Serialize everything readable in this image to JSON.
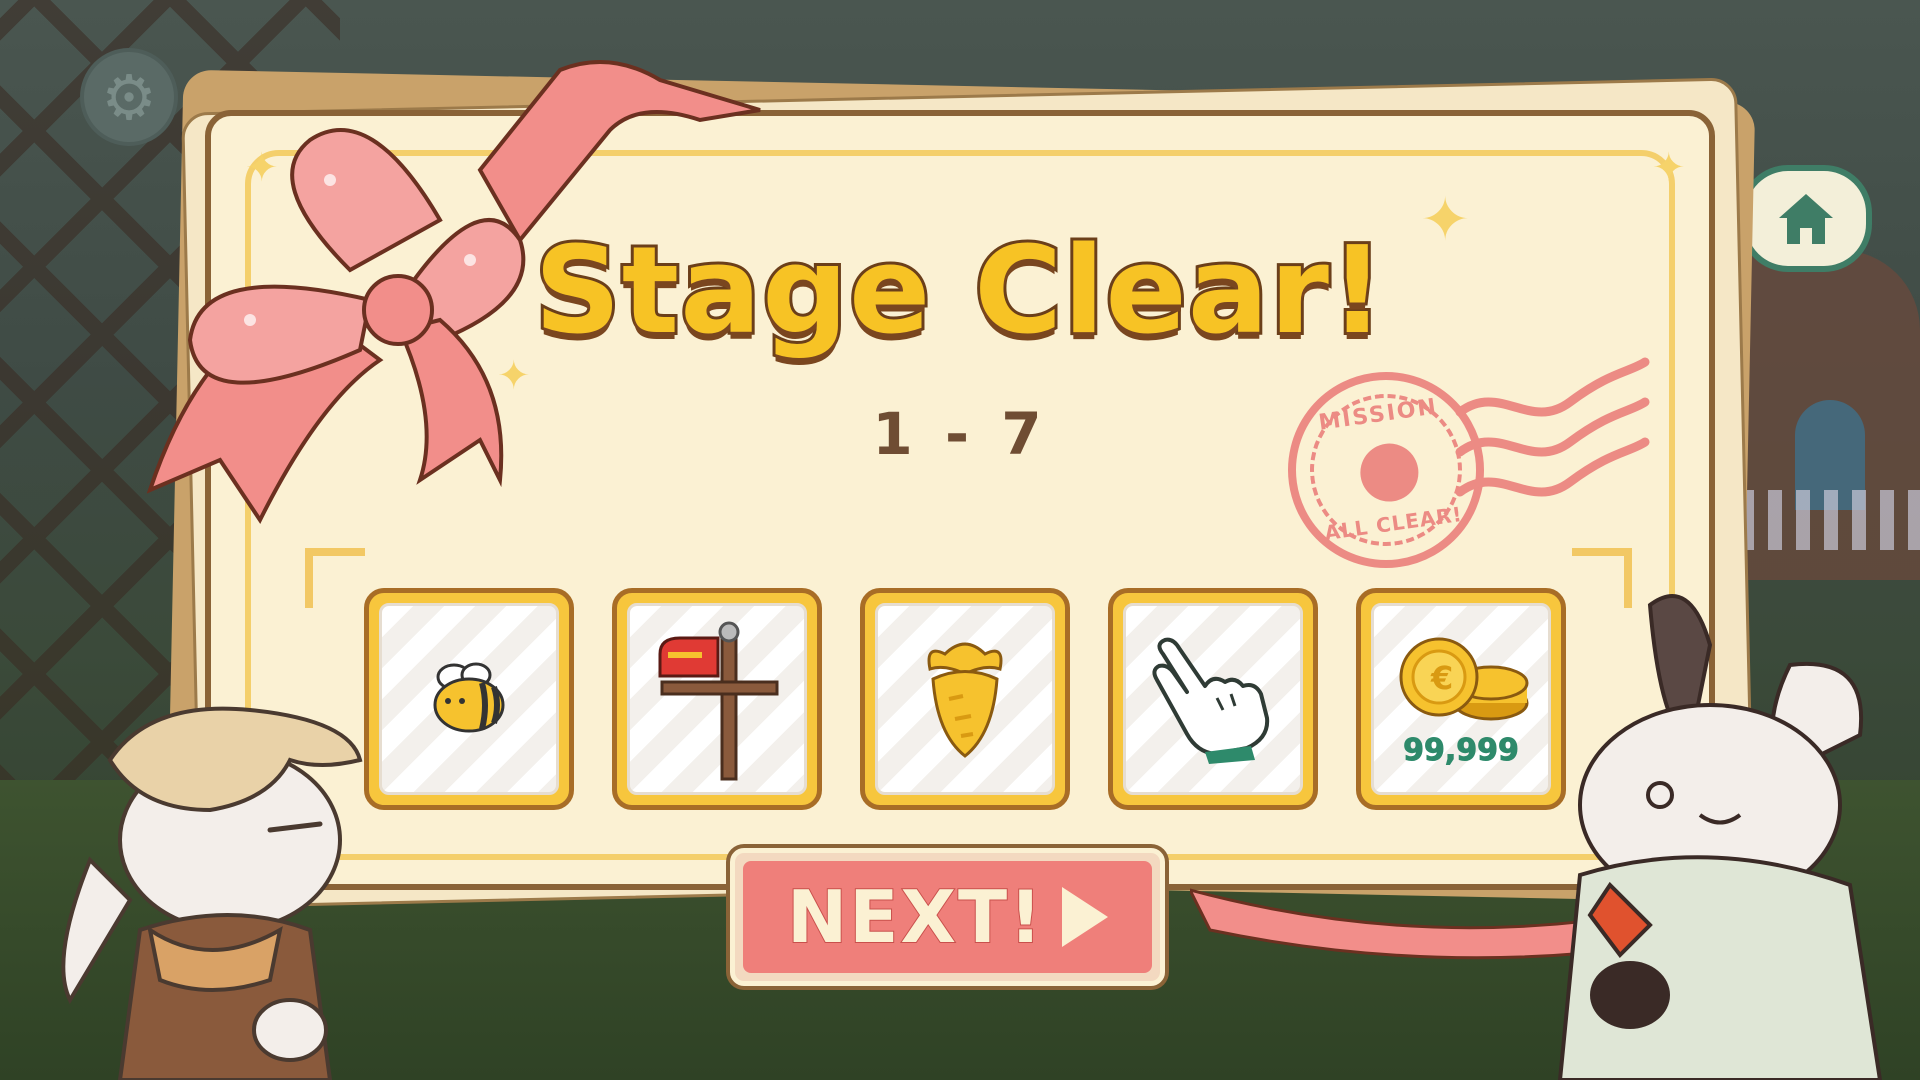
{
  "screen": {
    "title": "Stage Clear!",
    "stage_number": "1 - 7"
  },
  "stamp": {
    "top_text": "MISSION",
    "bottom_text": "ALL CLEAR!"
  },
  "rewards": [
    {
      "item": "bee",
      "icon": "bee-icon"
    },
    {
      "item": "mailbox",
      "icon": "mailbox-icon"
    },
    {
      "item": "carrot",
      "icon": "carrot-icon"
    },
    {
      "item": "pointer glove",
      "icon": "pointer-glove-icon"
    },
    {
      "item": "coins",
      "icon": "coins-icon",
      "count": "99,999"
    }
  ],
  "buttons": {
    "next_label": "NEXT!",
    "settings_icon": "gear-icon",
    "home_icon": "home-icon"
  },
  "colors": {
    "title_fill": "#f7c325",
    "title_outline": "#6b3f1a",
    "card_bg": "#fbf1d3",
    "next_button": "#ef7f7a",
    "coin_count": "#2e8a6b",
    "ribbon": "#f28e8a",
    "stamp": "#ec8b84"
  }
}
